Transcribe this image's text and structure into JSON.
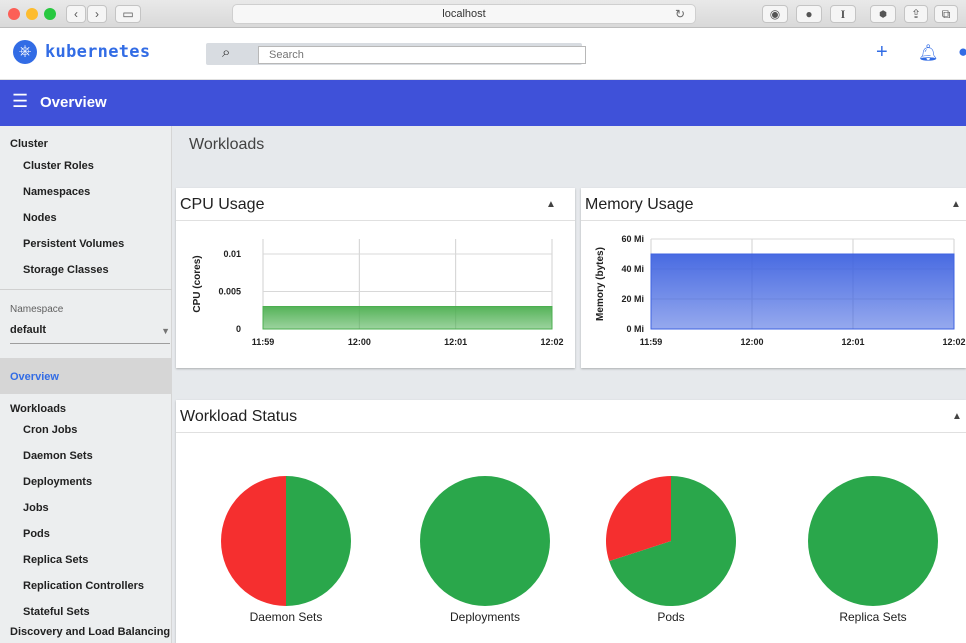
{
  "browser": {
    "address": "localhost"
  },
  "header": {
    "brand": "kubernetes",
    "search_placeholder": "Search"
  },
  "bluebar": {
    "title": "Overview"
  },
  "sidebar": {
    "cluster_heading": "Cluster",
    "cluster_items": [
      "Cluster Roles",
      "Namespaces",
      "Nodes",
      "Persistent Volumes",
      "Storage Classes"
    ],
    "namespace_label": "Namespace",
    "namespace_value": "default",
    "active_item": "Overview",
    "workloads_heading": "Workloads",
    "workload_items": [
      "Cron Jobs",
      "Daemon Sets",
      "Deployments",
      "Jobs",
      "Pods",
      "Replica Sets",
      "Replication Controllers",
      "Stateful Sets"
    ],
    "discovery_heading": "Discovery and Load Balancing"
  },
  "main": {
    "section_title": "Workloads",
    "cpu_card_title": "CPU Usage",
    "memory_card_title": "Memory Usage",
    "status_card_title": "Workload Status"
  },
  "chart_data": [
    {
      "type": "area",
      "title": "CPU Usage",
      "ylabel": "CPU (cores)",
      "x": [
        "11:59",
        "12:00",
        "12:01",
        "12:02"
      ],
      "yticks": [
        "0",
        "0.005",
        "0.01"
      ],
      "ylim": [
        0,
        0.012
      ],
      "series": [
        {
          "values": [
            0.003,
            0.003,
            0.003,
            0.003
          ]
        }
      ],
      "color": "#4caf50"
    },
    {
      "type": "area",
      "title": "Memory Usage",
      "ylabel": "Memory (bytes)",
      "x": [
        "11:59",
        "12:00",
        "12:01",
        "12:02"
      ],
      "yticks": [
        "0 Mi",
        "20 Mi",
        "40 Mi",
        "60 Mi"
      ],
      "ylim": [
        0,
        60
      ],
      "series": [
        {
          "values": [
            50,
            50,
            50,
            50
          ]
        }
      ],
      "color": "#3f63e0"
    },
    {
      "type": "pie",
      "title": "Workload Status",
      "charts": [
        {
          "label": "Daemon Sets",
          "success": 50,
          "failed": 50
        },
        {
          "label": "Deployments",
          "success": 100,
          "failed": 0
        },
        {
          "label": "Pods",
          "success": 70,
          "failed": 30
        },
        {
          "label": "Replica Sets",
          "success": 100,
          "failed": 0
        }
      ],
      "colors": {
        "success": "#2aa74b",
        "failed": "#f52f2f"
      }
    }
  ]
}
